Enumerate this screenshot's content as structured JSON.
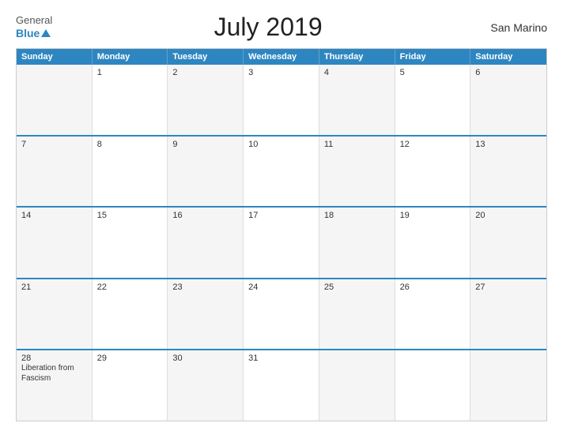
{
  "header": {
    "logo_general": "General",
    "logo_blue": "Blue",
    "title": "July 2019",
    "country": "San Marino"
  },
  "days_of_week": [
    "Sunday",
    "Monday",
    "Tuesday",
    "Wednesday",
    "Thursday",
    "Friday",
    "Saturday"
  ],
  "weeks": [
    [
      {
        "num": "",
        "event": ""
      },
      {
        "num": "1",
        "event": ""
      },
      {
        "num": "2",
        "event": ""
      },
      {
        "num": "3",
        "event": ""
      },
      {
        "num": "4",
        "event": ""
      },
      {
        "num": "5",
        "event": ""
      },
      {
        "num": "6",
        "event": ""
      }
    ],
    [
      {
        "num": "7",
        "event": ""
      },
      {
        "num": "8",
        "event": ""
      },
      {
        "num": "9",
        "event": ""
      },
      {
        "num": "10",
        "event": ""
      },
      {
        "num": "11",
        "event": ""
      },
      {
        "num": "12",
        "event": ""
      },
      {
        "num": "13",
        "event": ""
      }
    ],
    [
      {
        "num": "14",
        "event": ""
      },
      {
        "num": "15",
        "event": ""
      },
      {
        "num": "16",
        "event": ""
      },
      {
        "num": "17",
        "event": ""
      },
      {
        "num": "18",
        "event": ""
      },
      {
        "num": "19",
        "event": ""
      },
      {
        "num": "20",
        "event": ""
      }
    ],
    [
      {
        "num": "21",
        "event": ""
      },
      {
        "num": "22",
        "event": ""
      },
      {
        "num": "23",
        "event": ""
      },
      {
        "num": "24",
        "event": ""
      },
      {
        "num": "25",
        "event": ""
      },
      {
        "num": "26",
        "event": ""
      },
      {
        "num": "27",
        "event": ""
      }
    ],
    [
      {
        "num": "28",
        "event": "Liberation from Fascism"
      },
      {
        "num": "29",
        "event": ""
      },
      {
        "num": "30",
        "event": ""
      },
      {
        "num": "31",
        "event": ""
      },
      {
        "num": "",
        "event": ""
      },
      {
        "num": "",
        "event": ""
      },
      {
        "num": "",
        "event": ""
      }
    ]
  ]
}
